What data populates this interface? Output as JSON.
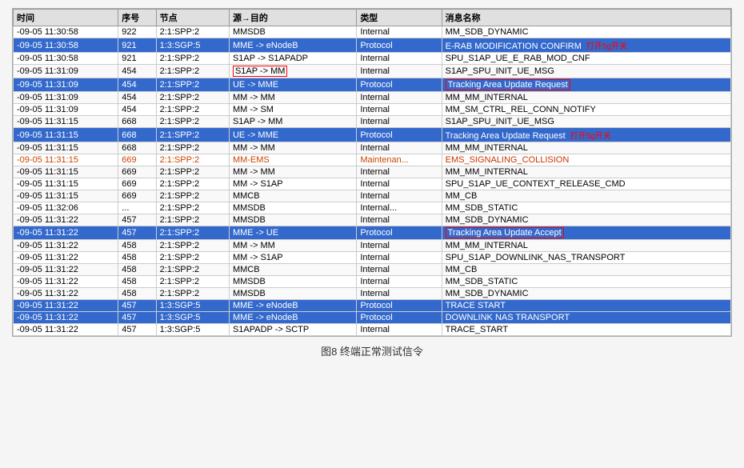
{
  "caption": "图8  终端正常测试信令",
  "columns": [
    "时间",
    "序号",
    "节点",
    "源→目的",
    "类型",
    "消息名称"
  ],
  "rows": [
    {
      "time": "-09-05 11:30:58",
      "seq": "922",
      "node": "2:1:SPP:2",
      "from": "MMSDB",
      "type": "Internal",
      "msg": "MM_SDB_DYNAMIC",
      "style": "normal"
    },
    {
      "time": "-09-05 11:30:58",
      "seq": "921",
      "node": "1:3:SGP:5",
      "from": "MME -> eNodeB",
      "type": "Protocol",
      "msg": "E-RAB MODIFICATION CONFIRM",
      "style": "blue",
      "annotation": "打开5g开关",
      "ann_right": true
    },
    {
      "time": "-09-05 11:30:58",
      "seq": "921",
      "node": "2:1:SPP:2",
      "from": "S1AP -> S1APADP",
      "type": "Internal",
      "msg": "SPU_S1AP_UE_E_RAB_MOD_CNF",
      "style": "normal"
    },
    {
      "time": "-09-05 11:31:09",
      "seq": "454",
      "node": "2:1:SPP:2",
      "from": "S1AP -> MM",
      "type": "Internal",
      "msg": "S1AP_SPU_INIT_UE_MSG",
      "style": "normal",
      "box_from": true
    },
    {
      "time": "-09-05 11:31:09",
      "seq": "454",
      "node": "2:1:SPP:2",
      "from": "UE -> MME",
      "type": "Protocol",
      "msg": "Tracking Area Update Request",
      "style": "blue",
      "box_msg": true
    },
    {
      "time": "-09-05 11:31:09",
      "seq": "454",
      "node": "2:1:SPP:2",
      "from": "MM -> MM",
      "type": "Internal",
      "msg": "MM_MM_INTERNAL",
      "style": "normal"
    },
    {
      "time": "-09-05 11:31:09",
      "seq": "454",
      "node": "2:1:SPP:2",
      "from": "MM -> SM",
      "type": "Internal",
      "msg": "MM_SM_CTRL_REL_CONN_NOTIFY",
      "style": "normal"
    },
    {
      "time": "-09-05 11:31:15",
      "seq": "668",
      "node": "2:1:SPP:2",
      "from": "S1AP -> MM",
      "type": "Internal",
      "msg": "S1AP_SPU_INIT_UE_MSG",
      "style": "normal"
    },
    {
      "time": "-09-05 11:31:15",
      "seq": "668",
      "node": "2:1:SPP:2",
      "from": "UE -> MME",
      "type": "Protocol",
      "msg": "Tracking Area Update Request",
      "style": "blue",
      "annotation": "打开5g开关",
      "ann_right": true
    },
    {
      "time": "-09-05 11:31:15",
      "seq": "668",
      "node": "2:1:SPP:2",
      "from": "MM -> MM",
      "type": "Internal",
      "msg": "MM_MM_INTERNAL",
      "style": "normal"
    },
    {
      "time": "-09-05 11:31:15",
      "seq": "669",
      "node": "2:1:SPP:2",
      "from": "MM-EMS",
      "type": "Maintenan...",
      "msg": "EMS_SIGNALING_COLLISION",
      "style": "orange"
    },
    {
      "time": "-09-05 11:31:15",
      "seq": "669",
      "node": "2:1:SPP:2",
      "from": "MM -> MM",
      "type": "Internal",
      "msg": "MM_MM_INTERNAL",
      "style": "normal"
    },
    {
      "time": "-09-05 11:31:15",
      "seq": "669",
      "node": "2:1:SPP:2",
      "from": "MM -> S1AP",
      "type": "Internal",
      "msg": "SPU_S1AP_UE_CONTEXT_RELEASE_CMD",
      "style": "normal"
    },
    {
      "time": "-09-05 11:31:15",
      "seq": "669",
      "node": "2:1:SPP:2",
      "from": "MMCB",
      "type": "Internal",
      "msg": "MM_CB",
      "style": "normal"
    },
    {
      "time": "-09-05 11:32:06",
      "seq": "...",
      "node": "2:1:SPP:2",
      "from": "MMSDB",
      "type": "Internal...",
      "msg": "MM_SDB_STATIC",
      "style": "normal"
    },
    {
      "time": "-09-05 11:31:22",
      "seq": "457",
      "node": "2:1:SPP:2",
      "from": "MMSDB",
      "type": "Internal",
      "msg": "MM_SDB_DYNAMIC",
      "style": "normal",
      "strike": true
    },
    {
      "time": "-09-05 11:31:22",
      "seq": "457",
      "node": "2:1:SPP:2",
      "from": "MME -> UE",
      "type": "Protocol",
      "msg": "Tracking Area Update Accept",
      "style": "blue",
      "box_msg": true
    },
    {
      "time": "-09-05 11:31:22",
      "seq": "458",
      "node": "2:1:SPP:2",
      "from": "MM -> MM",
      "type": "Internal",
      "msg": "MM_MM_INTERNAL",
      "style": "normal",
      "strikethrough": true
    },
    {
      "time": "-09-05 11:31:22",
      "seq": "458",
      "node": "2:1:SPP:2",
      "from": "MM -> S1AP",
      "type": "Internal",
      "msg": "SPU_S1AP_DOWNLINK_NAS_TRANSPORT",
      "style": "normal"
    },
    {
      "time": "-09-05 11:31:22",
      "seq": "458",
      "node": "2:1:SPP:2",
      "from": "MMCB",
      "type": "Internal",
      "msg": "MM_CB",
      "style": "normal"
    },
    {
      "time": "-09-05 11:31:22",
      "seq": "458",
      "node": "2:1:SPP:2",
      "from": "MMSDB",
      "type": "Internal",
      "msg": "MM_SDB_STATIC",
      "style": "normal"
    },
    {
      "time": "-09-05 11:31:22",
      "seq": "458",
      "node": "2:1:SPP:2",
      "from": "MMSDB",
      "type": "Internal",
      "msg": "MM_SDB_DYNAMIC",
      "style": "normal"
    },
    {
      "time": "-09-05 11:31:22",
      "seq": "457",
      "node": "1:3:SGP:5",
      "from": "MME -> eNodeB",
      "type": "Protocol",
      "msg": "TRACE START",
      "style": "blue"
    },
    {
      "time": "-09-05 11:31:22",
      "seq": "457",
      "node": "1:3:SGP:5",
      "from": "MME -> eNodeB",
      "type": "Protocol",
      "msg": "DOWNLINK NAS TRANSPORT",
      "style": "blue"
    },
    {
      "time": "-09-05 11:31:22",
      "seq": "457",
      "node": "1:3:SGP:5",
      "from": "S1APADP -> SCTP",
      "type": "Internal",
      "msg": "TRACE_START",
      "style": "normal"
    }
  ]
}
